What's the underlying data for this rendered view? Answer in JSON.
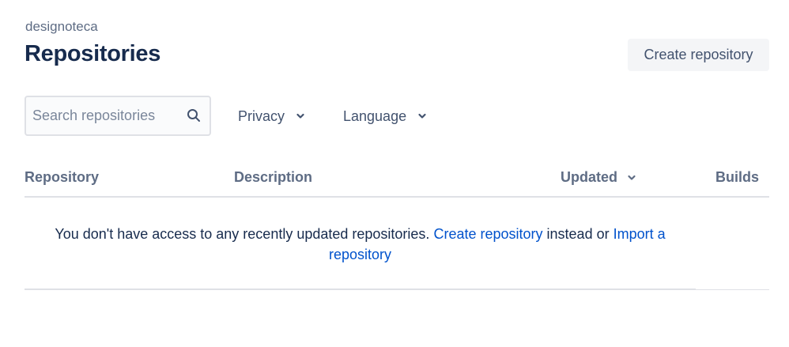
{
  "header": {
    "workspace": "designoteca",
    "title": "Repositories",
    "create_button": "Create repository"
  },
  "filters": {
    "search_placeholder": "Search repositories",
    "search_value": "",
    "privacy_label": "Privacy",
    "language_label": "Language"
  },
  "table": {
    "columns": {
      "repository": "Repository",
      "description": "Description",
      "updated": "Updated",
      "builds": "Builds"
    },
    "empty_message": {
      "prefix": "You don't have access to any recently updated repositories.",
      "create_link": "Create repository",
      "middle": "instead or",
      "import_link": "Import a repository"
    }
  },
  "icons": {
    "search": "search-icon",
    "privacy_chevron": "chevron-down-icon",
    "language_chevron": "chevron-down-icon",
    "sort_chevron": "chevron-down-icon"
  },
  "colors": {
    "link": "#0052cc",
    "heading": "#172b4d",
    "muted": "#5e6c84",
    "divider": "#dfe1e6"
  }
}
